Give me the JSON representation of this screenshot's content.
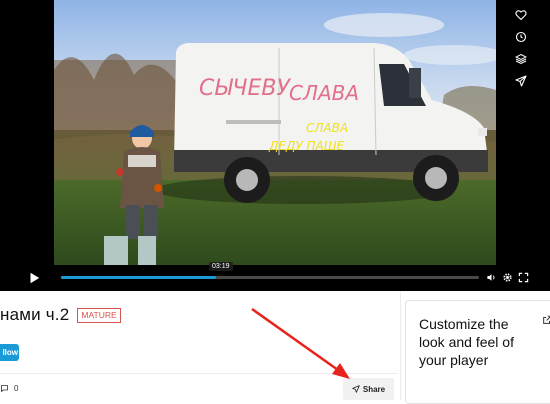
{
  "player": {
    "time_tooltip": "03:19",
    "progress": 0.37,
    "side_icons": [
      "heart-icon",
      "clock-icon",
      "layers-icon",
      "send-icon"
    ],
    "controls": [
      "play-icon",
      "volume-icon",
      "settings-icon",
      "fullscreen-icon"
    ],
    "graffiti": {
      "text1": "СЫЧЕВУ",
      "text2": "СЛАВА",
      "text3": "СЛАВА",
      "text4": "ДЕДУ ПАШЕ"
    }
  },
  "video_info": {
    "title": "нами ч.2",
    "badge": "MATURE",
    "follow_label": "llow",
    "comment_count": "0",
    "share_label": "Share"
  },
  "promo": {
    "text": "Customize the look and feel of your player"
  },
  "colors": {
    "accent": "#1a9bd7",
    "mature": "#d9534f",
    "annotation_arrow": "#e8231d"
  }
}
